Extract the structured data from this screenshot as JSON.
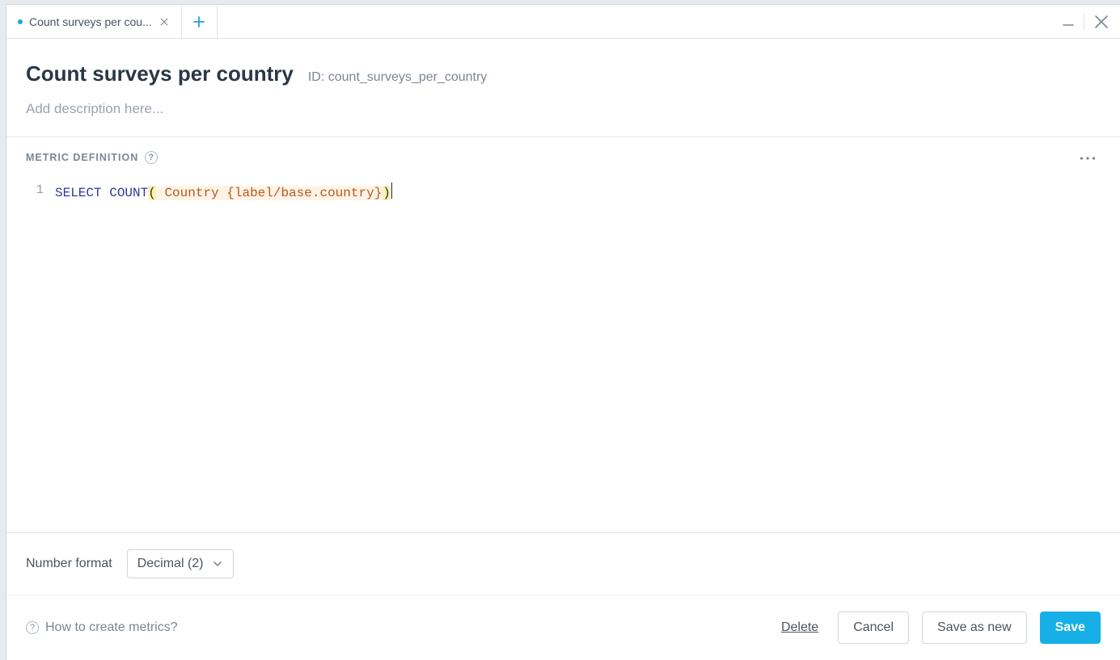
{
  "tab": {
    "label": "Count surveys per cou..."
  },
  "window": {
    "minimize_title": "Minimize",
    "close_title": "Close"
  },
  "header": {
    "title": "Count surveys per country",
    "id_label": "ID: count_surveys_per_country",
    "description_placeholder": "Add description here..."
  },
  "section": {
    "metric_definition_label": "METRIC DEFINITION"
  },
  "editor": {
    "line_number": "1",
    "kw_select": "SELECT",
    "kw_count": "COUNT",
    "paren_open": "(",
    "paren_close": ")",
    "token_text": " Country {label/base.country}"
  },
  "number_format": {
    "label": "Number format",
    "value": "Decimal (2)"
  },
  "footer": {
    "help_text": "How to create metrics?",
    "delete": "Delete",
    "cancel": "Cancel",
    "save_as_new": "Save as new",
    "save": "Save"
  }
}
